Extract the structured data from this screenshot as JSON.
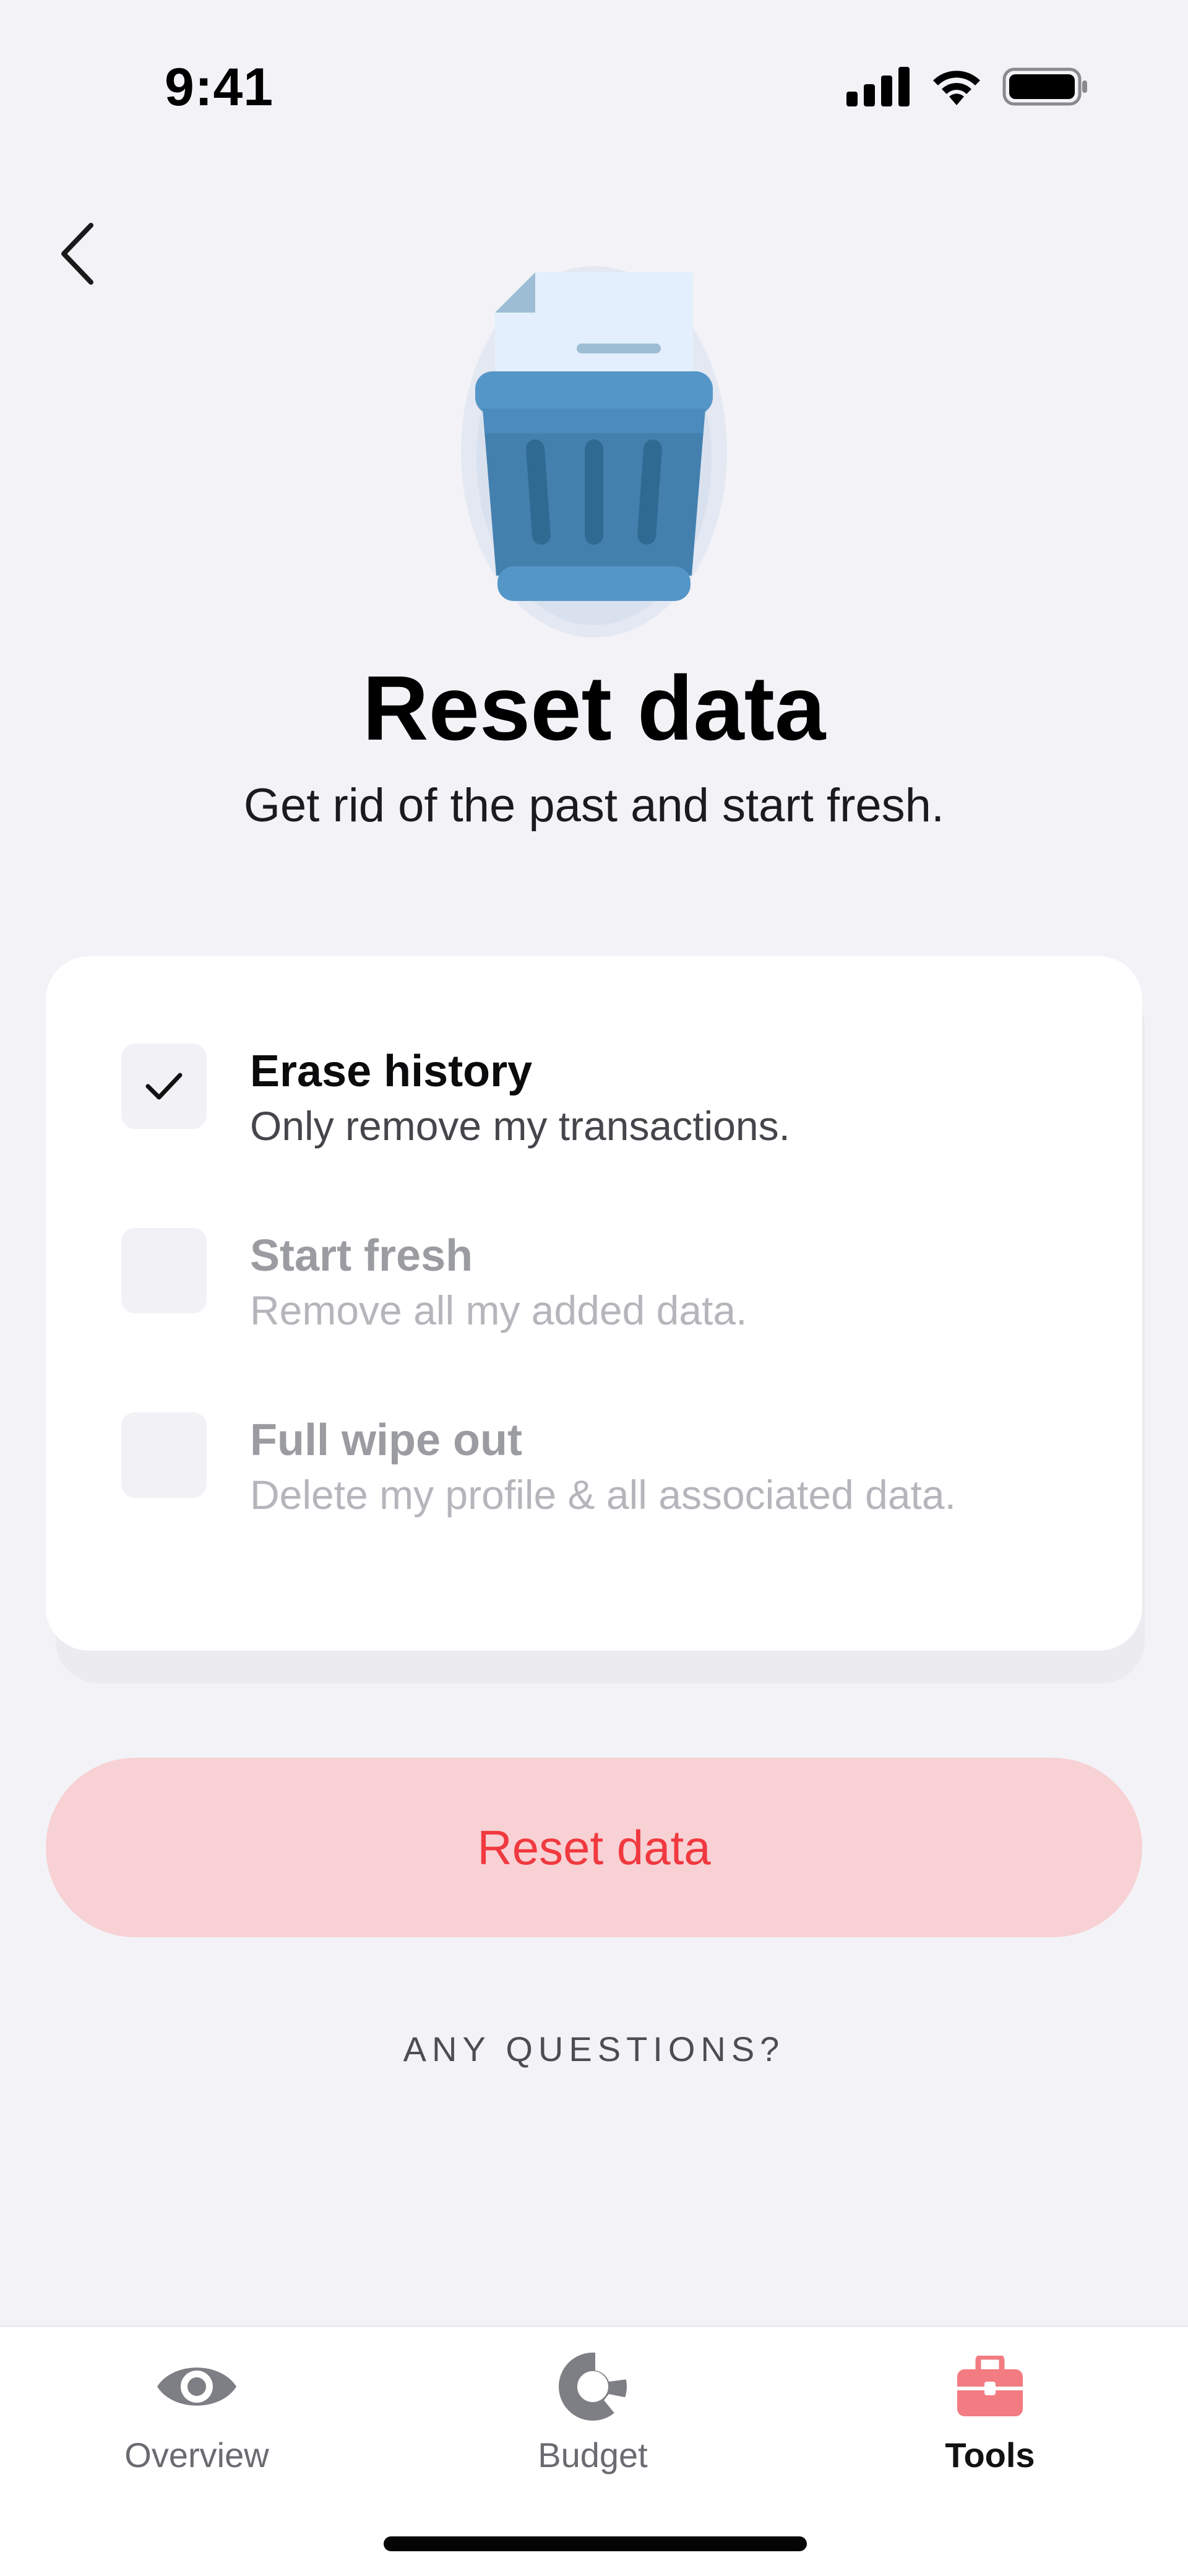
{
  "status_bar": {
    "time": "9:41"
  },
  "icons": {
    "back": "chevron-left-icon",
    "illustration": "trash-bin-icon",
    "check": "checkmark-icon",
    "overview": "eye-icon",
    "budget": "donut-chart-icon",
    "tools": "toolbox-icon"
  },
  "header": {
    "title": "Reset data",
    "subtitle": "Get rid of the past and start fresh."
  },
  "options": [
    {
      "title": "Erase history",
      "description": "Only remove my transactions.",
      "checked": true
    },
    {
      "title": "Start fresh",
      "description": "Remove all my added data.",
      "checked": false
    },
    {
      "title": "Full wipe out",
      "description": "Delete my profile & all associated data.",
      "checked": false
    }
  ],
  "actions": {
    "reset_label": "Reset data",
    "questions_label": "ANY QUESTIONS?"
  },
  "tab_bar": {
    "items": [
      {
        "label": "Overview",
        "active": false
      },
      {
        "label": "Budget",
        "active": false
      },
      {
        "label": "Tools",
        "active": true
      }
    ]
  },
  "colors": {
    "background": "#f3f3f7",
    "accent_red": "#f0393f",
    "button_bg": "#f7d1d4",
    "tools_active": "#f27c82",
    "bin_blue": "#4a88b8"
  }
}
